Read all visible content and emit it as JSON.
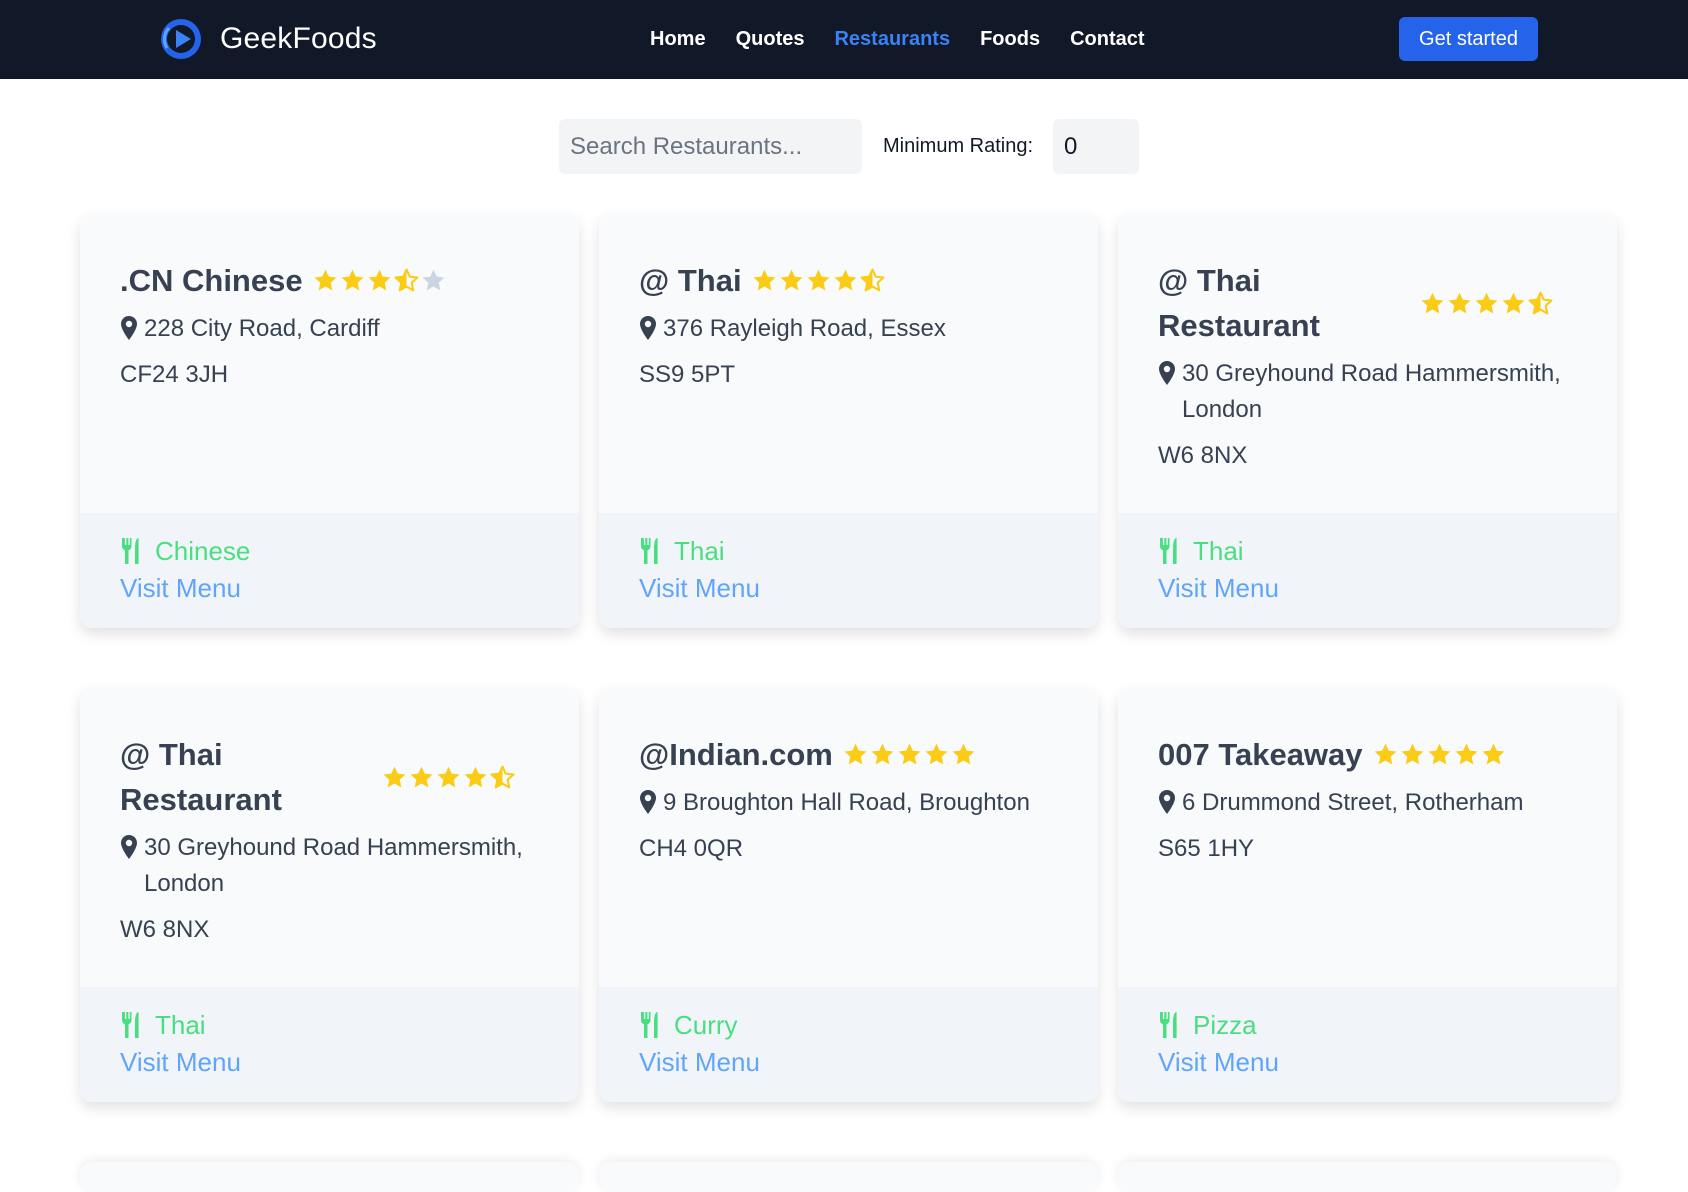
{
  "brand": {
    "name": "GeekFoods",
    "logo_icon": "play-logo-icon"
  },
  "nav": {
    "items": [
      {
        "label": "Home",
        "active": false
      },
      {
        "label": "Quotes",
        "active": false
      },
      {
        "label": "Restaurants",
        "active": true
      },
      {
        "label": "Foods",
        "active": false
      },
      {
        "label": "Contact",
        "active": false
      }
    ]
  },
  "cta": {
    "label": "Get started"
  },
  "filters": {
    "search_placeholder": "Search Restaurants...",
    "min_rating_label": "Minimum Rating:",
    "min_rating_value": "0"
  },
  "colors": {
    "header_bg": "#111827",
    "accent": "#2563eb",
    "active_nav": "#3b82f6",
    "star": "#facc15",
    "star_empty": "#cbd5e1",
    "cuisine": "#4ade80",
    "link": "#60a5fa"
  },
  "restaurants": [
    {
      "name": ".CN Chinese",
      "rating": 3.5,
      "address": "228 City Road, Cardiff",
      "postcode": "CF24 3JH",
      "cuisine": "Chinese",
      "link": "Visit Menu",
      "wrap": false
    },
    {
      "name": "@ Thai",
      "rating": 4.5,
      "address": "376 Rayleigh Road, Essex",
      "postcode": "SS9 5PT",
      "cuisine": "Thai",
      "link": "Visit Menu",
      "wrap": false
    },
    {
      "name": "@ Thai Restaurant",
      "rating": 4.5,
      "address": "30 Greyhound Road Hammersmith, London",
      "postcode": "W6 8NX",
      "cuisine": "Thai",
      "link": "Visit Menu",
      "wrap": true
    },
    {
      "name": "@ Thai Restaurant",
      "rating": 4.5,
      "address": "30 Greyhound Road Hammersmith, London",
      "postcode": "W6 8NX",
      "cuisine": "Thai",
      "link": "Visit Menu",
      "wrap": true
    },
    {
      "name": "@Indian.com",
      "rating": 5,
      "address": "9 Broughton Hall Road, Broughton",
      "postcode": "CH4 0QR",
      "cuisine": "Curry",
      "link": "Visit Menu",
      "wrap": false
    },
    {
      "name": "007 Takeaway",
      "rating": 5,
      "address": "6 Drummond Street, Rotherham",
      "postcode": "S65 1HY",
      "cuisine": "Pizza",
      "link": "Visit Menu",
      "wrap": false
    }
  ]
}
